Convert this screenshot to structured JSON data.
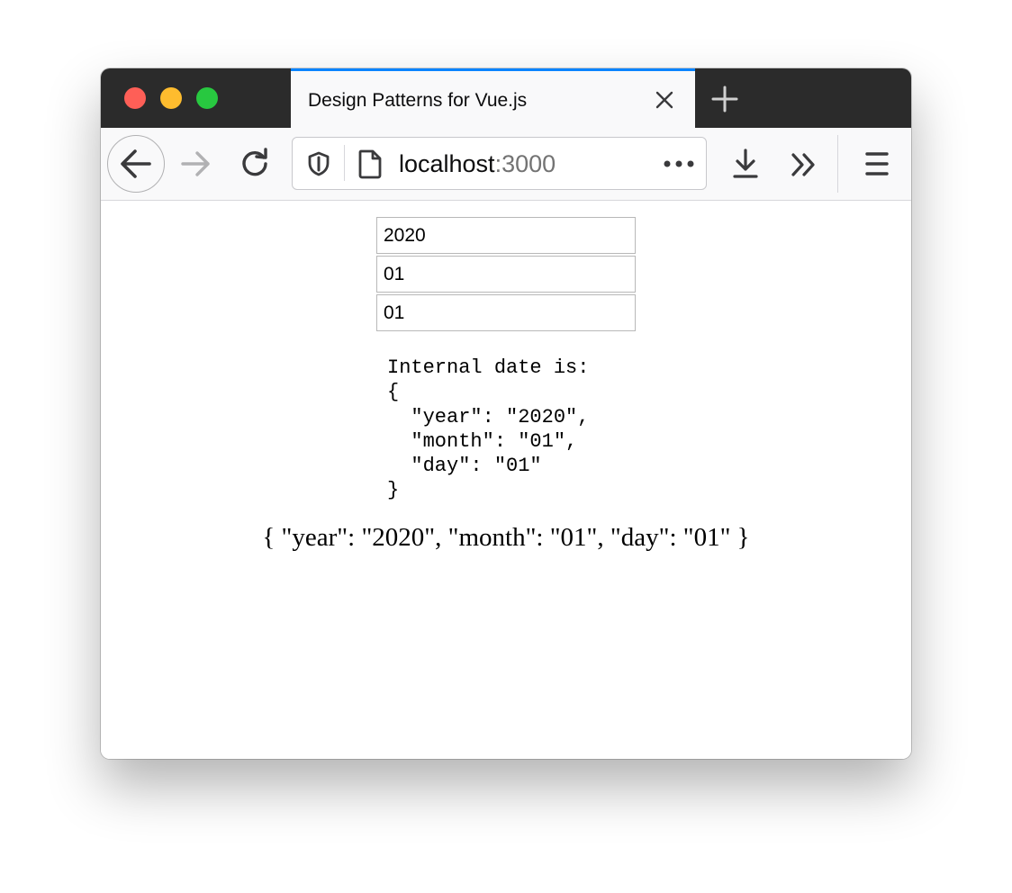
{
  "browser": {
    "tab_title": "Design Patterns for Vue.js",
    "url_host": "localhost",
    "url_port": ":3000",
    "icons": [
      "close-window-light",
      "minimize-window-light",
      "zoom-window-light",
      "tab-close-icon",
      "new-tab-icon",
      "back-arrow-icon",
      "forward-arrow-icon",
      "reload-icon",
      "shield-icon",
      "page-icon",
      "more-actions-icon",
      "download-icon",
      "overflow-chevron-icon",
      "hamburger-menu-icon"
    ],
    "colors": {
      "titlebar": "#2b2b2b",
      "tab_accent": "#0a84ff",
      "toolbar": "#f9f9fa"
    }
  },
  "form": {
    "year": "2020",
    "month": "01",
    "day": "01"
  },
  "output": {
    "internal_date_block": "Internal date is:\n{\n  \"year\": \"2020\",\n  \"month\": \"01\",\n  \"day\": \"01\"\n}",
    "inline_json": "{ \"year\": \"2020\", \"month\": \"01\", \"day\": \"01\" }"
  }
}
